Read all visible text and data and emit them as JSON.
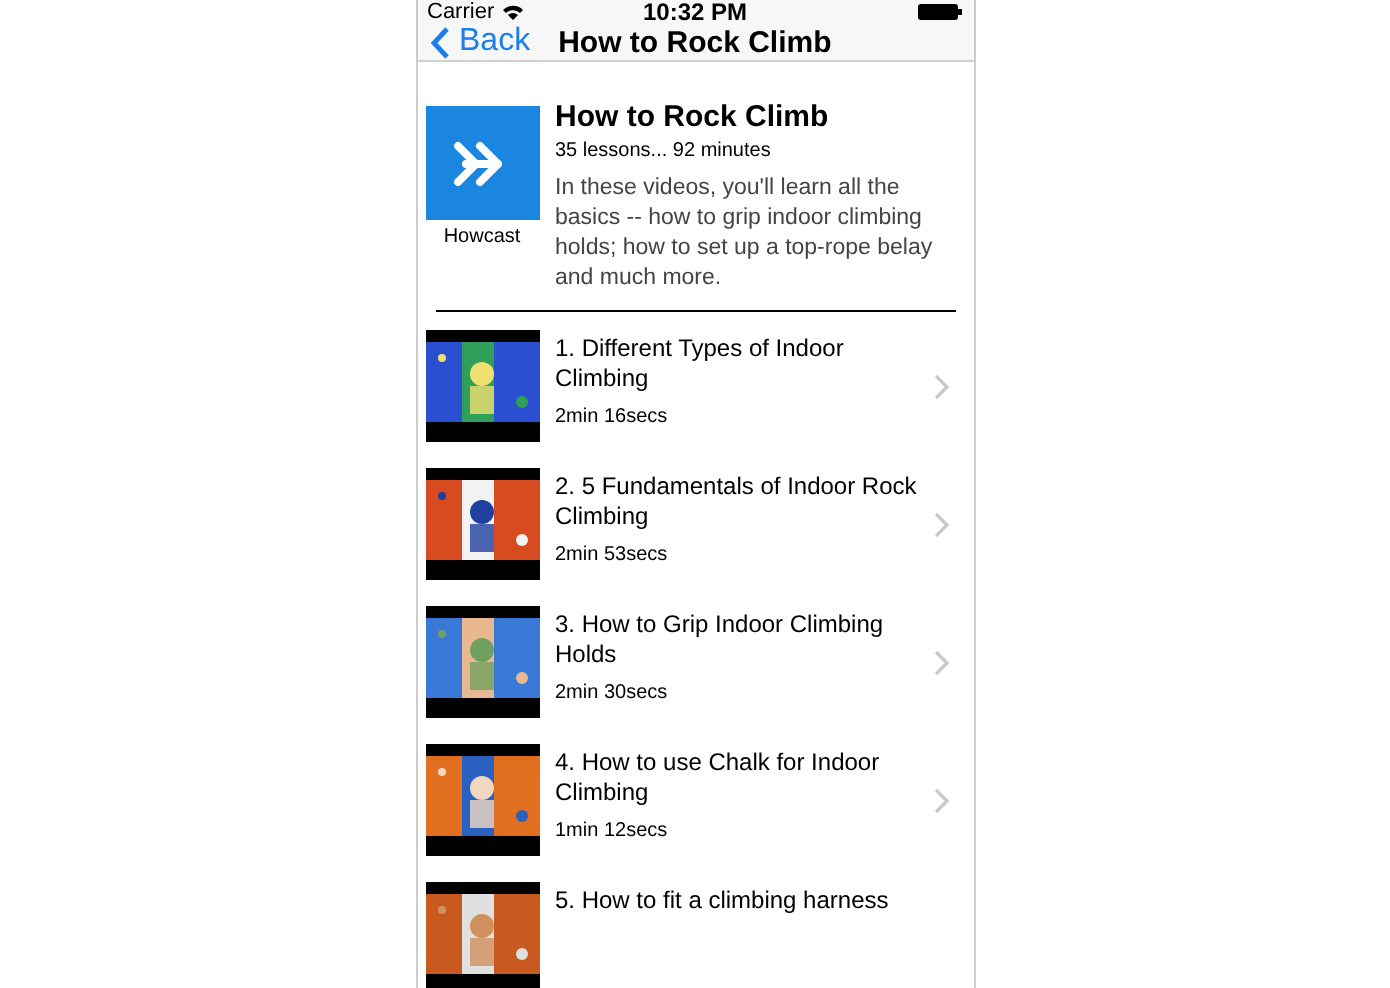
{
  "status_bar": {
    "carrier": "Carrier",
    "time": "10:32 PM"
  },
  "nav_bar": {
    "back": "Back",
    "title": "How to Rock Climb"
  },
  "course": {
    "logo_caption": "Howcast",
    "title": "How to Rock Climb",
    "meta": "35 lessons... 92 minutes",
    "description": "In these videos, you'll learn all the basics -- how to grip indoor climbing holds; how to set up a top-rope belay and much more."
  },
  "lessons": [
    {
      "title": "1. Different Types of Indoor Climbing",
      "duration": "2min 16secs"
    },
    {
      "title": "2. 5 Fundamentals of Indoor Rock Climbing",
      "duration": "2min 53secs"
    },
    {
      "title": "3. How to Grip Indoor Climbing Holds",
      "duration": "2min 30secs"
    },
    {
      "title": "4. How to use Chalk for Indoor Climbing",
      "duration": "1min 12secs"
    },
    {
      "title": "5. How to fit a climbing harness"
    }
  ]
}
